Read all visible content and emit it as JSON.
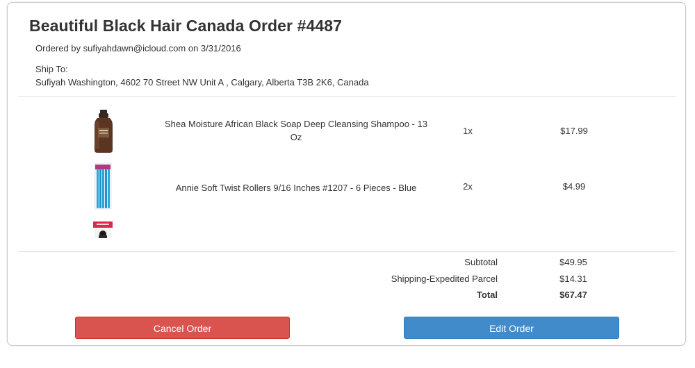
{
  "order": {
    "title": "Beautiful Black Hair Canada Order #4487",
    "ordered_by": "Ordered by sufiyahdawn@icloud.com on 3/31/2016",
    "ship_to_label": "Ship To:",
    "ship_address": "Sufiyah Washington, 4602 70 Street NW Unit A , Calgary, Alberta T3B 2K6, Canada"
  },
  "items": [
    {
      "name": "Shea Moisture African Black Soap Deep Cleansing Shampoo - 13 Oz",
      "qty": "1x",
      "price": "$17.99",
      "thumb_icon": "shampoo-bottle-icon"
    },
    {
      "name": "Annie Soft Twist Rollers 9/16 Inches #1207 - 6 Pieces - Blue",
      "qty": "2x",
      "price": "$4.99",
      "thumb_icon": "twist-rollers-icon"
    },
    {
      "name": "",
      "qty": "",
      "price": "",
      "thumb_icon": "product-package-icon"
    }
  ],
  "summary": {
    "subtotal_label": "Subtotal",
    "subtotal_value": "$49.95",
    "shipping_label": "Shipping-Expedited Parcel",
    "shipping_value": "$14.31",
    "total_label": "Total",
    "total_value": "$67.47"
  },
  "actions": {
    "cancel_label": "Cancel Order",
    "edit_label": "Edit Order"
  },
  "colors": {
    "cancel": "#d9534f",
    "edit": "#428bca"
  }
}
